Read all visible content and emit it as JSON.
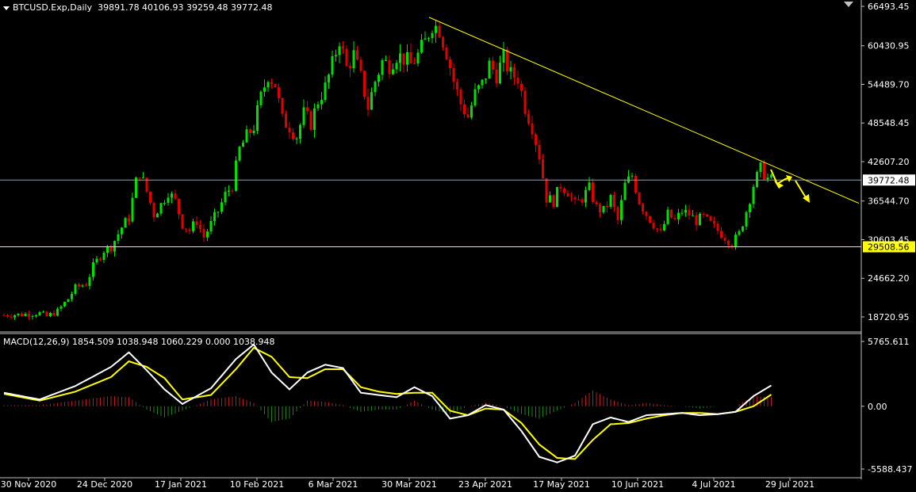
{
  "header": {
    "symbol": "BTCUSD.Exp,Daily",
    "ohlc": "39891.78 40106.93 39259.48 39772.48"
  },
  "macd_label": "MACD(12,26,9) 1854.509 1038.948 1060.229 0.000 1038.948",
  "colors": {
    "background": "#000000",
    "bull": "#00e000",
    "bear": "#e00000",
    "trendline": "#ffff00",
    "signal": "#ffff00",
    "macd_line": "#ffffff",
    "hist_pos": "#b02020",
    "hist_neg": "#208020",
    "current_price_line": "#8da0c0"
  },
  "chart_data": [
    {
      "type": "candlestick",
      "title": "BTCUSD.Exp,Daily",
      "ylim": [
        15000,
        67000
      ],
      "price_ticks": [
        "66493.45",
        "60430.95",
        "54489.70",
        "48548.45",
        "42607.20",
        "36544.70",
        "30603.45",
        "24662.20",
        "18720.95"
      ],
      "price_tick_values": [
        66493.45,
        60430.95,
        54489.7,
        48548.45,
        42607.2,
        36544.7,
        30603.45,
        24662.2,
        18720.95
      ],
      "x_labels": [
        "30 Nov 2020",
        "24 Dec 2020",
        "17 Jan 2021",
        "10 Feb 2021",
        "6 Mar 2021",
        "30 Mar 2021",
        "23 Apr 2021",
        "17 May 2021",
        "10 Jun 2021",
        "4 Jul 2021",
        "29 Jul 2021"
      ],
      "current_price": "39772.48",
      "current_price_value": 39772.48,
      "support_level": "29508.56",
      "support_value": 29508.56,
      "trendline": {
        "from_price": 64800,
        "to_price": 36200
      },
      "close_path": [
        [
          0,
          19000
        ],
        [
          5,
          19100
        ],
        [
          10,
          19300
        ],
        [
          12,
          18800
        ],
        [
          15,
          19600
        ],
        [
          18,
          21500
        ],
        [
          20,
          23200
        ],
        [
          23,
          23800
        ],
        [
          25,
          26500
        ],
        [
          28,
          29000
        ],
        [
          30,
          29500
        ],
        [
          33,
          32500
        ],
        [
          35,
          34000
        ],
        [
          37,
          39500
        ],
        [
          38,
          41000
        ],
        [
          40,
          38000
        ],
        [
          42,
          34500
        ],
        [
          44,
          36000
        ],
        [
          46,
          38000
        ],
        [
          48,
          36500
        ],
        [
          50,
          33000
        ],
        [
          52,
          32000
        ],
        [
          54,
          33500
        ],
        [
          56,
          31000
        ],
        [
          58,
          33000
        ],
        [
          60,
          35000
        ],
        [
          62,
          37500
        ],
        [
          64,
          39000
        ],
        [
          66,
          44500
        ],
        [
          68,
          46500
        ],
        [
          70,
          48000
        ],
        [
          72,
          52500
        ],
        [
          74,
          56000
        ],
        [
          76,
          54500
        ],
        [
          78,
          49000
        ],
        [
          80,
          48000
        ],
        [
          82,
          46500
        ],
        [
          84,
          50000
        ],
        [
          86,
          48500
        ],
        [
          88,
          52000
        ],
        [
          90,
          54000
        ],
        [
          92,
          57500
        ],
        [
          94,
          61500
        ],
        [
          96,
          57000
        ],
        [
          98,
          59000
        ],
        [
          100,
          55500
        ],
        [
          102,
          51000
        ],
        [
          104,
          55000
        ],
        [
          106,
          58000
        ],
        [
          108,
          57500
        ],
        [
          110,
          59000
        ],
        [
          112,
          58500
        ],
        [
          114,
          57500
        ],
        [
          116,
          59000
        ],
        [
          118,
          61000
        ],
        [
          120,
          63800
        ],
        [
          122,
          63000
        ],
        [
          124,
          59500
        ],
        [
          126,
          55000
        ],
        [
          128,
          51500
        ],
        [
          130,
          49500
        ],
        [
          132,
          53000
        ],
        [
          134,
          54500
        ],
        [
          136,
          57500
        ],
        [
          138,
          56000
        ],
        [
          140,
          58500
        ],
        [
          142,
          56000
        ],
        [
          144,
          55500
        ],
        [
          146,
          51000
        ],
        [
          148,
          48000
        ],
        [
          150,
          43500
        ],
        [
          152,
          37000
        ],
        [
          154,
          36500
        ],
        [
          156,
          39000
        ],
        [
          158,
          38000
        ],
        [
          160,
          36000
        ],
        [
          162,
          37000
        ],
        [
          164,
          38500
        ],
        [
          166,
          35500
        ],
        [
          168,
          35000
        ],
        [
          170,
          37000
        ],
        [
          172,
          33500
        ],
        [
          174,
          39000
        ],
        [
          176,
          40500
        ],
        [
          178,
          36500
        ],
        [
          180,
          34500
        ],
        [
          182,
          33000
        ],
        [
          184,
          31500
        ],
        [
          186,
          34500
        ],
        [
          188,
          33500
        ],
        [
          190,
          35000
        ],
        [
          192,
          34500
        ],
        [
          194,
          33500
        ],
        [
          196,
          34000
        ],
        [
          198,
          33000
        ],
        [
          200,
          32000
        ],
        [
          202,
          31000
        ],
        [
          204,
          30000
        ],
        [
          206,
          31500
        ],
        [
          208,
          35000
        ],
        [
          210,
          39000
        ],
        [
          212,
          41500
        ],
        [
          214,
          40000
        ],
        [
          215,
          39772
        ]
      ]
    },
    {
      "type": "macd",
      "title": "MACD(12,26,9) 1854.509 1038.948 1060.229 0.000 1038.948",
      "ylim": [
        -6200,
        6300
      ],
      "ticks": [
        "5765.611",
        "0.00",
        "-5588.437"
      ],
      "tick_values": [
        5765.611,
        0.0,
        -5588.437
      ],
      "main": 1854.509,
      "signal": 1038.948,
      "macd_path": [
        [
          0,
          1200
        ],
        [
          10,
          600
        ],
        [
          20,
          1800
        ],
        [
          30,
          3500
        ],
        [
          35,
          4800
        ],
        [
          40,
          3200
        ],
        [
          45,
          1500
        ],
        [
          50,
          200
        ],
        [
          58,
          1600
        ],
        [
          65,
          4200
        ],
        [
          70,
          5500
        ],
        [
          75,
          3000
        ],
        [
          80,
          1500
        ],
        [
          85,
          3000
        ],
        [
          90,
          3700
        ],
        [
          95,
          3400
        ],
        [
          100,
          1200
        ],
        [
          105,
          1000
        ],
        [
          110,
          800
        ],
        [
          115,
          1700
        ],
        [
          120,
          900
        ],
        [
          125,
          -1100
        ],
        [
          130,
          -800
        ],
        [
          135,
          100
        ],
        [
          140,
          -300
        ],
        [
          145,
          -2200
        ],
        [
          150,
          -4500
        ],
        [
          155,
          -5000
        ],
        [
          160,
          -4400
        ],
        [
          165,
          -1600
        ],
        [
          170,
          -1000
        ],
        [
          175,
          -1400
        ],
        [
          180,
          -800
        ],
        [
          185,
          -700
        ],
        [
          190,
          -600
        ],
        [
          195,
          -800
        ],
        [
          200,
          -700
        ],
        [
          205,
          -500
        ],
        [
          210,
          900
        ],
        [
          215,
          1855
        ]
      ],
      "signal_path": [
        [
          0,
          1100
        ],
        [
          10,
          500
        ],
        [
          20,
          1300
        ],
        [
          30,
          2600
        ],
        [
          35,
          4000
        ],
        [
          40,
          3500
        ],
        [
          45,
          2500
        ],
        [
          50,
          600
        ],
        [
          58,
          1000
        ],
        [
          65,
          3300
        ],
        [
          70,
          5200
        ],
        [
          75,
          4400
        ],
        [
          80,
          2600
        ],
        [
          85,
          2500
        ],
        [
          90,
          3300
        ],
        [
          95,
          3300
        ],
        [
          100,
          1700
        ],
        [
          105,
          1300
        ],
        [
          110,
          1100
        ],
        [
          115,
          1200
        ],
        [
          120,
          1200
        ],
        [
          125,
          -400
        ],
        [
          130,
          -800
        ],
        [
          135,
          -200
        ],
        [
          140,
          -300
        ],
        [
          145,
          -1500
        ],
        [
          150,
          -3400
        ],
        [
          155,
          -4600
        ],
        [
          160,
          -4700
        ],
        [
          165,
          -3000
        ],
        [
          170,
          -1600
        ],
        [
          175,
          -1500
        ],
        [
          180,
          -1100
        ],
        [
          185,
          -800
        ],
        [
          190,
          -600
        ],
        [
          195,
          -600
        ],
        [
          200,
          -700
        ],
        [
          205,
          -500
        ],
        [
          210,
          0
        ],
        [
          215,
          1039
        ]
      ]
    }
  ]
}
